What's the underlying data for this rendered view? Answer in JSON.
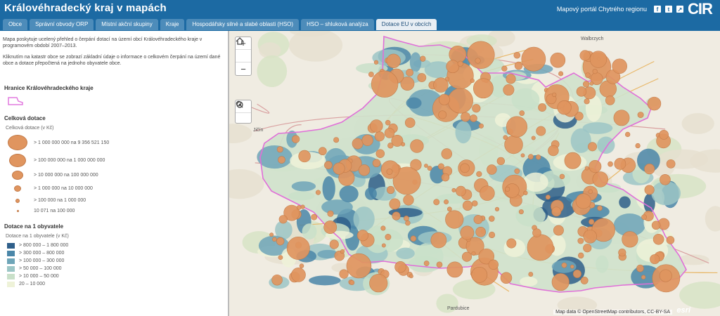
{
  "header": {
    "title": "Královéhradecký kraj v mapách",
    "portal_link": "Mapový portál Chytrého regionu",
    "logo_text": "CIR"
  },
  "tabs": [
    {
      "label": "Obce",
      "active": false
    },
    {
      "label": "Správní obvody ORP",
      "active": false
    },
    {
      "label": "Místní akční skupiny",
      "active": false
    },
    {
      "label": "Kraje",
      "active": false
    },
    {
      "label": "Hospodářsky silné a slabé oblasti (HSO)",
      "active": false
    },
    {
      "label": "HSO – shluková analýza",
      "active": false
    },
    {
      "label": "Dotace EU v obcích",
      "active": true
    }
  ],
  "sidebar": {
    "intro_p1": "Mapa poskytuje ucelený přehled o čerpání dotací na území obcí Královéhradeckého kraje v programovém období 2007–2013.",
    "intro_p2": "Kliknutím na katastr obce se zobrazí základní údaje o informace o celkovém čerpání na území dané obce a dotace přepočtená na jednoho obyvatele obce.",
    "boundary_heading": "Hranice Královéhradeckého kraje",
    "total_heading": "Celková dotace",
    "total_sub": "Celková dotace (v Kč)",
    "total_classes": [
      {
        "label": "> 1 000 000 000 na 9 356 521 150"
      },
      {
        "label": "> 100 000 000 na 1 000 000 000"
      },
      {
        "label": "> 10 000 000 na 100 000 000"
      },
      {
        "label": "> 1 000 000 na 10 000 000"
      },
      {
        "label": "> 100 000 na 1 000 000"
      },
      {
        "label": "10 071 na 100 000"
      }
    ],
    "percap_heading": "Dotace na 1 obyvatele",
    "percap_sub": "Dotace na 1 obyvatele (v Kč)",
    "percap_classes": [
      {
        "label": "> 800 000 – 1 800 000",
        "color": "#2f5f8a"
      },
      {
        "label": "> 300 000 – 800 000",
        "color": "#4a86a8"
      },
      {
        "label": "> 100 000 – 300 000",
        "color": "#6ea5b8"
      },
      {
        "label": "> 50 000 – 100 000",
        "color": "#9cc6c6"
      },
      {
        "label": "> 10 000 – 50 000",
        "color": "#c9e0c9"
      },
      {
        "label": "20 – 10 000",
        "color": "#eef2d8"
      }
    ]
  },
  "map": {
    "zoom_in": "+",
    "home_icon": "home-icon",
    "zoom_out": "−",
    "attribution": "Map data © OpenStreetMap contributors, CC-BY-SA",
    "esri": "esri",
    "labels": [
      {
        "text": "Jičín"
      },
      {
        "text": "Walbrzych"
      },
      {
        "text": "Pardubice"
      }
    ]
  }
}
